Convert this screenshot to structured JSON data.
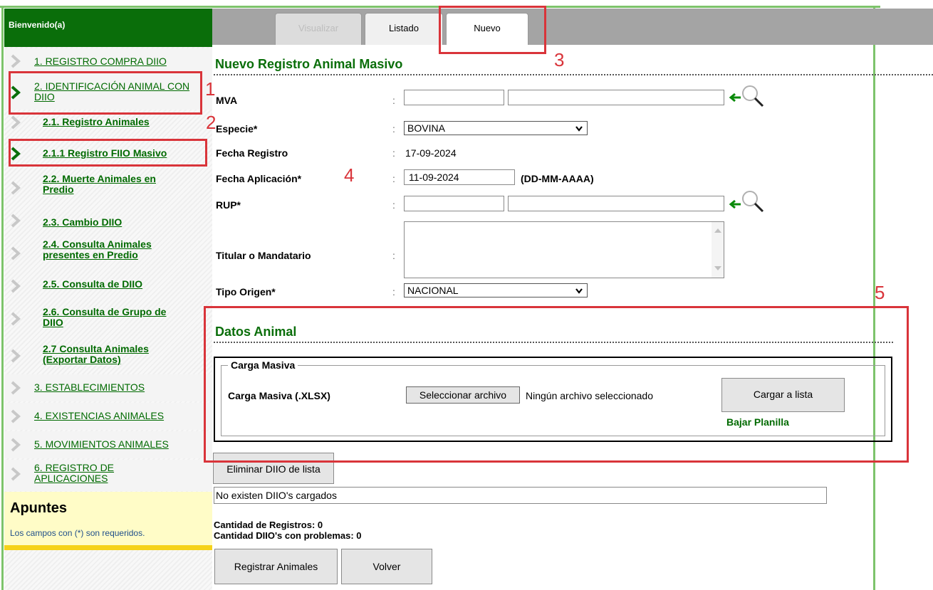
{
  "sidebar": {
    "welcome": "Bienvenido(a)",
    "items": [
      {
        "label": "1. REGISTRO COMPRA DIIO"
      },
      {
        "label": "2. IDENTIFICACIÓN ANIMAL CON DIIO"
      },
      {
        "label": "2.1. Registro Animales"
      },
      {
        "label": "2.1.1 Registro FIIO Masivo"
      },
      {
        "label": "2.2. Muerte Animales en Predio"
      },
      {
        "label": "2.3. Cambio DIIO"
      },
      {
        "label": "2.4. Consulta Animales presentes en Predio"
      },
      {
        "label": "2.5. Consulta de DIIO"
      },
      {
        "label": "2.6. Consulta de Grupo de DIIO"
      },
      {
        "label": "2.7 Consulta Animales (Exportar Datos)"
      },
      {
        "label": "3. ESTABLECIMIENTOS"
      },
      {
        "label": "4. EXISTENCIAS ANIMALES"
      },
      {
        "label": "5. MOVIMIENTOS ANIMALES"
      },
      {
        "label": "6. REGISTRO DE APLICACIONES"
      }
    ],
    "notes_title": "Apuntes",
    "notes_text": "Los campos con (*) son requeridos."
  },
  "tabs": [
    {
      "label": "Visualizar",
      "state": "disabled"
    },
    {
      "label": "Listado",
      "state": "normal"
    },
    {
      "label": "Nuevo",
      "state": "active"
    }
  ],
  "form": {
    "title": "Nuevo Registro Animal Masivo",
    "separator": ":",
    "mva_label": "MVA",
    "mva_code": "",
    "mva_name": "",
    "especie_label": "Especie*",
    "especie_value": "BOVINA",
    "fecha_registro_label": "Fecha Registro",
    "fecha_registro_value": "17-09-2024",
    "fecha_aplicacion_label": "Fecha Aplicación*",
    "fecha_aplicacion_value": "11-09-2024",
    "fecha_format": "(DD-MM-AAAA)",
    "rup_label": "RUP*",
    "rup_code": "",
    "rup_name": "",
    "titular_label": "Titular o Mandatario",
    "titular_value": "",
    "tipo_origen_label": "Tipo Origen*",
    "tipo_origen_value": "NACIONAL"
  },
  "datos_animal": {
    "title": "Datos Animal",
    "fieldset_legend": "Carga Masiva",
    "upload_label": "Carga Masiva (.XLSX)",
    "file_button": "Seleccionar archivo",
    "file_status": "Ningún archivo seleccionado",
    "load_button": "Cargar a lista",
    "download_link": "Bajar Planilla"
  },
  "list": {
    "delete_button": "Eliminar DIIO de lista",
    "empty_message": "No existen DIIO's cargados",
    "count_records": "Cantidad de Registros: 0",
    "count_problems": "Cantidad DIIO's con problemas: 0"
  },
  "actions": {
    "register_button": "Registrar Animales",
    "back_button": "Volver"
  },
  "annotations": {
    "step1": "1",
    "step2": "2",
    "step3": "3",
    "step4": "4",
    "step5": "5"
  },
  "colors": {
    "brand_green": "#0a6e0a",
    "annotation_red": "#d9343a",
    "notes_bg": "#fffcc7"
  }
}
